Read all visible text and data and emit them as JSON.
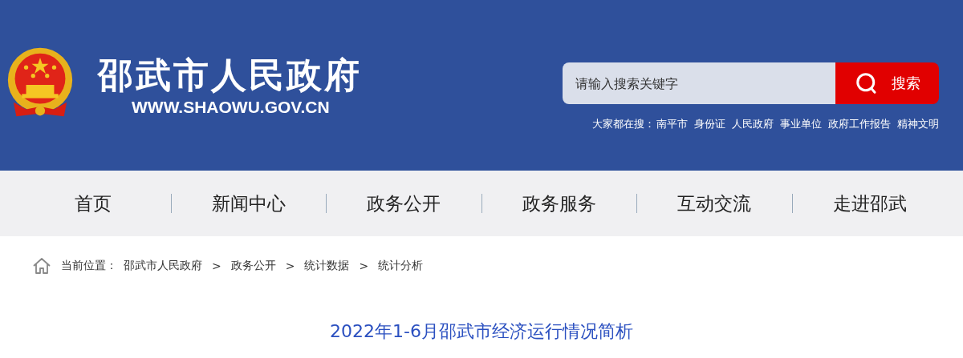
{
  "header": {
    "site_name": "邵武市人民政府",
    "site_url": "WWW.SHAOWU.GOV.CN",
    "search": {
      "placeholder": "请输入搜索关键字",
      "button": "搜索"
    },
    "hot_label": "大家都在搜：",
    "hot_searches": [
      "南平市",
      "身份证",
      "人民政府",
      "事业单位",
      "政府工作报告",
      "精神文明"
    ]
  },
  "nav": [
    "首页",
    "新闻中心",
    "政务公开",
    "政务服务",
    "互动交流",
    "走进邵武"
  ],
  "breadcrumb": {
    "label": "当前位置：",
    "separator": ">",
    "items": [
      "邵武市人民政府",
      "政务公开",
      "统计数据",
      "统计分析"
    ]
  },
  "article": {
    "title": "2022年1-6月邵武市经济运行情况简析"
  }
}
